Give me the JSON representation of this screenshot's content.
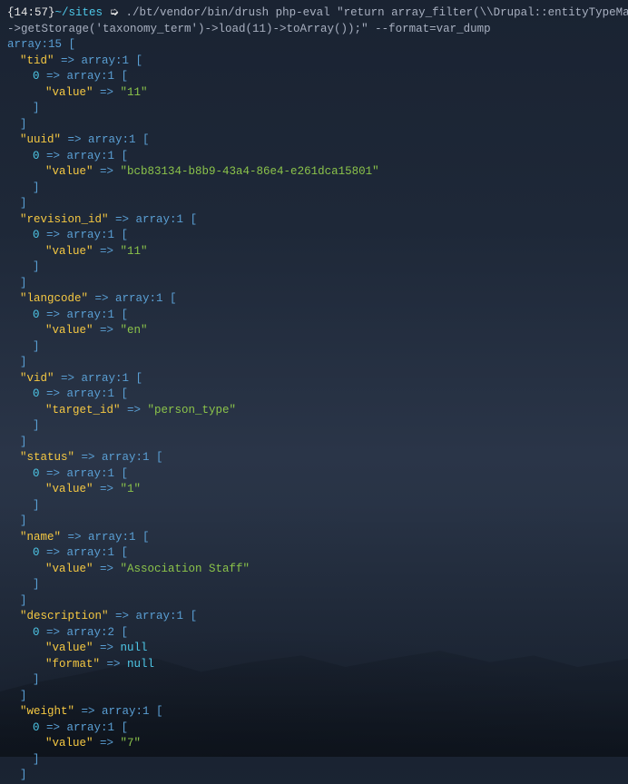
{
  "prompt": {
    "time": "{14:57}",
    "path": "~/sites",
    "arrow": "➭",
    "command": "./bt/vendor/bin/drush php-eval \"return array_filter(\\\\Drupal::entityTypeManager()",
    "command2": "->getStorage('taxonomy_term')->load(11)->toArray());\" --format=var_dump"
  },
  "output": {
    "root": "array:15",
    "fields": {
      "tid": {
        "key": "\"tid\"",
        "type": "array:1",
        "index": "0",
        "indexType": "array:1",
        "valueKey": "\"value\"",
        "value": "\"11\""
      },
      "uuid": {
        "key": "\"uuid\"",
        "type": "array:1",
        "index": "0",
        "indexType": "array:1",
        "valueKey": "\"value\"",
        "value": "\"bcb83134-b8b9-43a4-86e4-e261dca15801\""
      },
      "revision_id": {
        "key": "\"revision_id\"",
        "type": "array:1",
        "index": "0",
        "indexType": "array:1",
        "valueKey": "\"value\"",
        "value": "\"11\""
      },
      "langcode": {
        "key": "\"langcode\"",
        "type": "array:1",
        "index": "0",
        "indexType": "array:1",
        "valueKey": "\"value\"",
        "value": "\"en\""
      },
      "vid": {
        "key": "\"vid\"",
        "type": "array:1",
        "index": "0",
        "indexType": "array:1",
        "valueKey": "\"target_id\"",
        "value": "\"person_type\""
      },
      "status": {
        "key": "\"status\"",
        "type": "array:1",
        "index": "0",
        "indexType": "array:1",
        "valueKey": "\"value\"",
        "value": "\"1\""
      },
      "name": {
        "key": "\"name\"",
        "type": "array:1",
        "index": "0",
        "indexType": "array:1",
        "valueKey": "\"value\"",
        "value": "\"Association Staff\""
      },
      "description": {
        "key": "\"description\"",
        "type": "array:1",
        "index": "0",
        "indexType": "array:2",
        "valueKey1": "\"value\"",
        "value1": "null",
        "valueKey2": "\"format\"",
        "value2": "null"
      },
      "weight": {
        "key": "\"weight\"",
        "type": "array:1",
        "index": "0",
        "indexType": "array:1",
        "valueKey": "\"value\"",
        "value": "\"7\""
      }
    },
    "arrow": " => ",
    "bracketOpen": " [",
    "bracketClose": "]"
  }
}
